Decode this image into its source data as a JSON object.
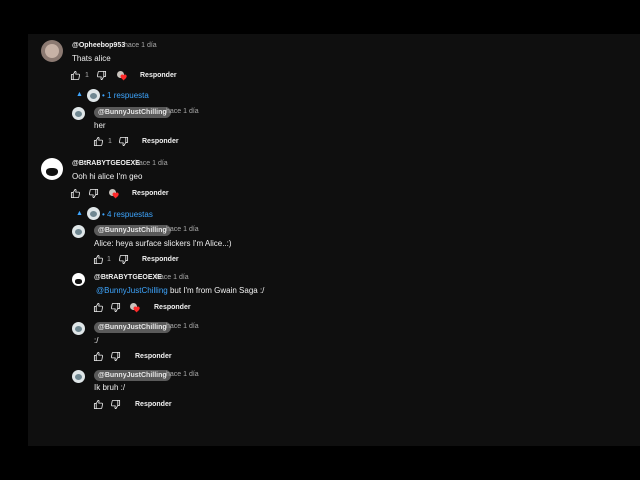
{
  "comments": [
    {
      "author": "@Opheebop953",
      "time": "hace 1 día",
      "text": "Thats alice",
      "likes": "1",
      "reply_label": "Responder",
      "toggle_label": "1 respuesta",
      "replies": [
        {
          "author": "@BunnyJustChilling",
          "time": "hace 1 día",
          "text": "her",
          "likes": "1",
          "reply_label": "Responder"
        }
      ]
    },
    {
      "author": "@BtRABYTGEOEXE",
      "time": "hace 1 día",
      "text": "Ooh hi alice I'm geo",
      "reply_label": "Responder",
      "toggle_label": "4 respuestas",
      "replies": [
        {
          "author": "@BunnyJustChilling",
          "time": "hace 1 día",
          "text": "Alice: heya surface slickers I'm Alice..:)",
          "likes": "1",
          "reply_label": "Responder"
        },
        {
          "author": "@BtRABYTGEOEXE",
          "time": "hace 1 día",
          "mention": "@BunnyJustChilling",
          "text": " but I'm from Gwain Saga :/",
          "reply_label": "Responder"
        },
        {
          "author": "@BunnyJustChilling",
          "time": "hace 1 día",
          "text": ":/",
          "reply_label": "Responder"
        },
        {
          "author": "@BunnyJustChilling",
          "time": "hace 1 día",
          "text": "Ik bruh :/",
          "reply_label": "Responder"
        }
      ]
    }
  ],
  "colors": {
    "background": "#0f0f0f",
    "letterbox": "#000000",
    "link": "#3ea6ff",
    "text": "#f1f1f1",
    "muted": "#aaaaaa"
  },
  "icons": [
    "thumbs-up-icon",
    "thumbs-down-icon",
    "creator-heart-icon",
    "caret-up-icon"
  ]
}
